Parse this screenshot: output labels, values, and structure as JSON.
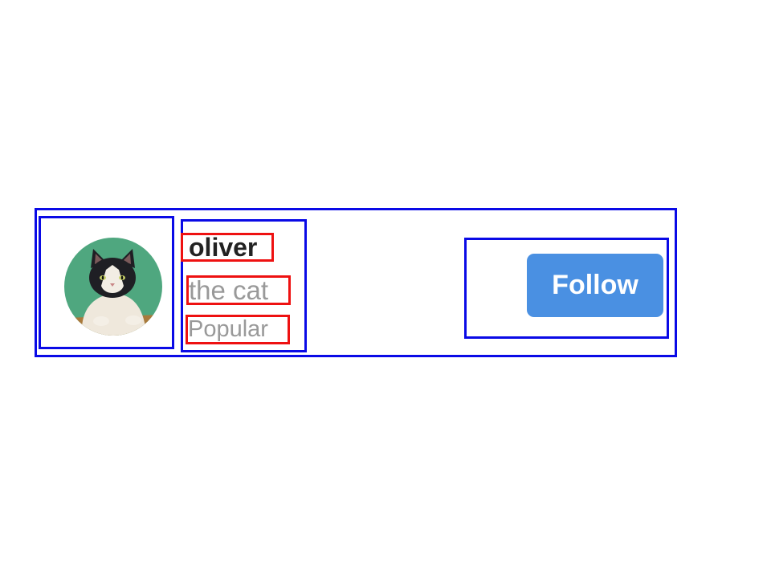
{
  "profile": {
    "name": "oliver",
    "subtitle": "the cat",
    "tag": "Popular",
    "avatar_icon": "cat-photo"
  },
  "actions": {
    "follow_label": "Follow"
  },
  "colors": {
    "container_outline": "#0a0ae6",
    "text_outline": "#ee1111",
    "follow_button": "#4a90e2",
    "name_text": "#222222",
    "secondary_text": "#999999"
  }
}
